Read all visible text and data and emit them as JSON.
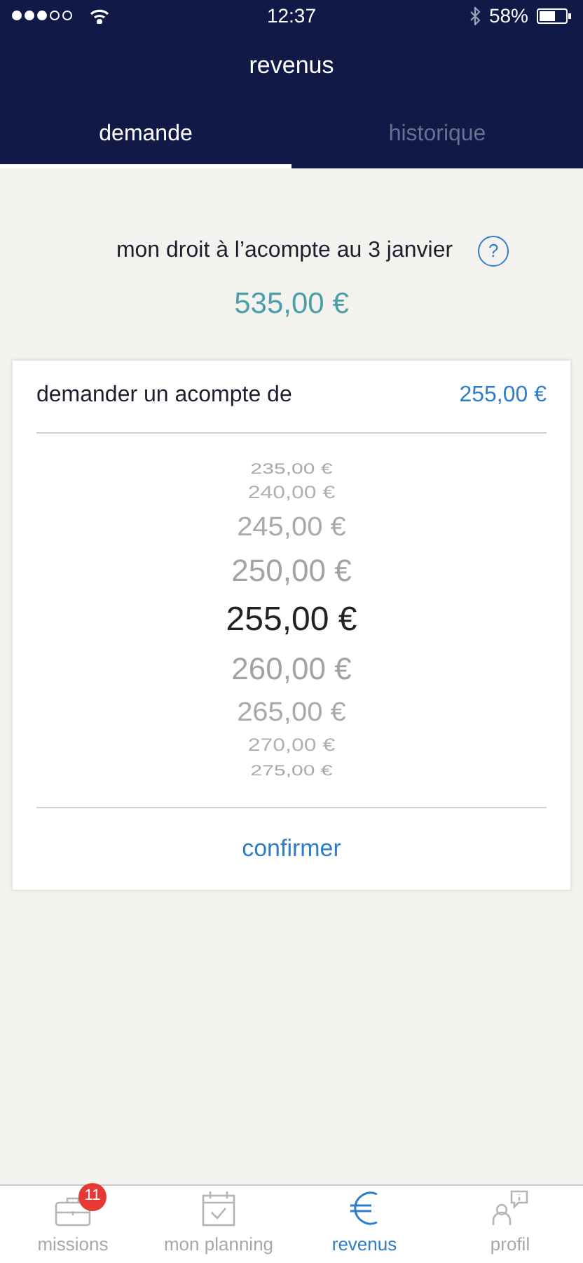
{
  "status_bar": {
    "time": "12:37",
    "battery": "58%"
  },
  "title": "revenus",
  "tabs": [
    {
      "label": "demande",
      "selected": true
    },
    {
      "label": "historique",
      "selected": false
    }
  ],
  "entitlement": {
    "label": "mon droit à l’acompte au 3 janvier",
    "help": "?",
    "amount": "535,00 €"
  },
  "request": {
    "label": "demander un acompte de",
    "amount": "255,00 €",
    "picker": [
      {
        "label": "235,00 €",
        "selected": false
      },
      {
        "label": "240,00 €",
        "selected": false
      },
      {
        "label": "245,00 €",
        "selected": false
      },
      {
        "label": "250,00 €",
        "selected": false
      },
      {
        "label": "255,00 €",
        "selected": true
      },
      {
        "label": "260,00 €",
        "selected": false
      },
      {
        "label": "265,00 €",
        "selected": false
      },
      {
        "label": "270,00 €",
        "selected": false
      },
      {
        "label": "275,00 €",
        "selected": false
      }
    ],
    "confirm": "confirmer"
  },
  "tab_bar": [
    {
      "kind": "briefcase",
      "label": "missions",
      "badge": "11",
      "selected": false
    },
    {
      "kind": "calendar",
      "label": "mon planning",
      "selected": false
    },
    {
      "kind": "euro",
      "label": "revenus",
      "selected": true
    },
    {
      "kind": "profile",
      "label": "profil",
      "selected": false
    }
  ]
}
